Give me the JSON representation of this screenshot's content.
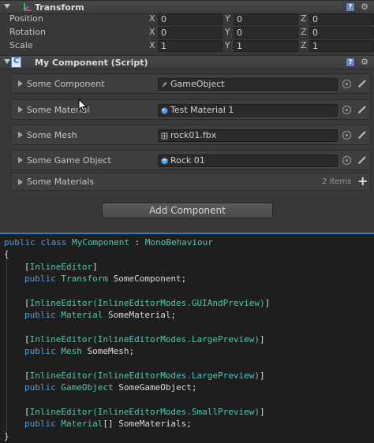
{
  "transform": {
    "title": "Transform",
    "rows": [
      {
        "label": "Position",
        "x": "0",
        "y": "0",
        "z": "0"
      },
      {
        "label": "Rotation",
        "x": "0",
        "y": "0",
        "z": "0"
      },
      {
        "label": "Scale",
        "x": "1",
        "y": "1",
        "z": "1"
      }
    ],
    "axes": [
      "X",
      "Y",
      "Z"
    ]
  },
  "component": {
    "title": "My Component (Script)",
    "slots": [
      {
        "label": "Some Component",
        "value": "GameObject",
        "icon": "gameobject-icon"
      },
      {
        "label": "Some Material",
        "value": "Test Material 1",
        "icon": "material-icon"
      },
      {
        "label": "Some Mesh",
        "value": "rock01.fbx",
        "icon": "mesh-icon"
      },
      {
        "label": "Some Game Object",
        "value": "Rock 01",
        "icon": "prefab-icon"
      }
    ],
    "materials": {
      "label": "Some Materials",
      "count": "2 items",
      "add": "+"
    }
  },
  "add_component": "Add Component",
  "code": {
    "l1": {
      "kw": "public class ",
      "ty": "MyComponent",
      "rest": " : ",
      "ty2": "MonoBehaviour"
    },
    "open": "{",
    "close": "}",
    "a1": "InlineEditor",
    "a1b": "",
    "d1": {
      "kw": "public ",
      "ty": "Transform",
      "rest": " SomeComponent;"
    },
    "a2": "InlineEditor(InlineEditorModes.GUIAndPreview)",
    "d2": {
      "kw": "public ",
      "ty": "Material",
      "rest": " SomeMaterial;"
    },
    "a3": "InlineEditor(InlineEditorModes.LargePreview)",
    "d3": {
      "kw": "public ",
      "ty": "Mesh",
      "rest": " SomeMesh;"
    },
    "a4": "InlineEditor(InlineEditorModes.LargePreview)",
    "d4": {
      "kw": "public ",
      "ty": "GameObject",
      "rest": " SomeGameObject;"
    },
    "a5": "InlineEditor(InlineEditorModes.SmallPreview)",
    "d5": {
      "kw": "public ",
      "ty": "Material",
      "rest": "[] SomeMaterials;"
    }
  },
  "colors": {
    "keyword": "#569cd6",
    "type": "#4ec9b0",
    "accent": "#2b7ec0"
  }
}
